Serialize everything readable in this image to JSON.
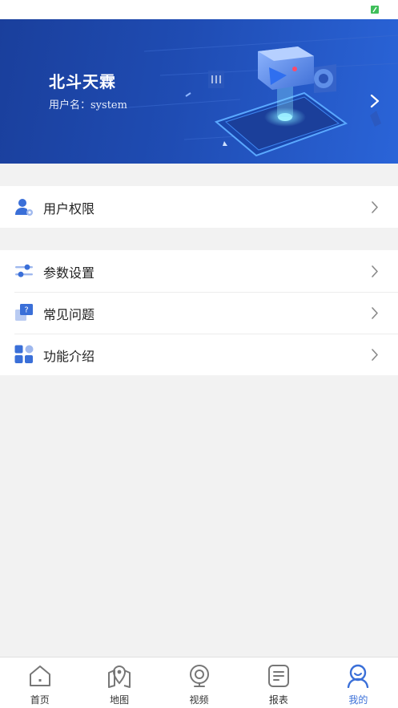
{
  "colors": {
    "accent": "#3a6fd8",
    "banner": "#1f4cb3",
    "background": "#f2f2f2",
    "battery": "#3fbf5a"
  },
  "status_bar": {
    "battery_icon": "battery-charging-icon"
  },
  "profile": {
    "company": "北斗天霖",
    "username_label": "用户名：",
    "username": "system"
  },
  "menu_groups": [
    {
      "items": [
        {
          "label": "用户权限",
          "icon": "user-permission-icon"
        }
      ]
    },
    {
      "items": [
        {
          "label": "参数设置",
          "icon": "sliders-icon"
        },
        {
          "label": "常见问题",
          "icon": "faq-icon"
        },
        {
          "label": "功能介绍",
          "icon": "apps-grid-icon"
        }
      ]
    }
  ],
  "tabbar": {
    "active": "我的",
    "tabs": [
      {
        "label": "首页",
        "icon": "home-icon"
      },
      {
        "label": "地图",
        "icon": "map-pin-icon"
      },
      {
        "label": "视频",
        "icon": "camera-icon"
      },
      {
        "label": "报表",
        "icon": "report-icon"
      },
      {
        "label": "我的",
        "icon": "profile-icon"
      }
    ]
  }
}
